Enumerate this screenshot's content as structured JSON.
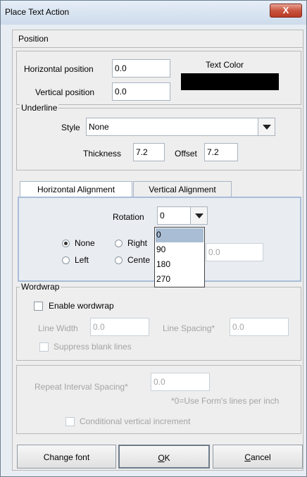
{
  "window": {
    "title": "Place Text Action",
    "close_label": "X"
  },
  "position_section": {
    "title": "Position",
    "horizontal_label": "Horizontal position",
    "horizontal_value": "0.0",
    "vertical_label": "Vertical position",
    "vertical_value": "0.0",
    "text_color_label": "Text Color",
    "text_color": "#000000"
  },
  "underline": {
    "title": "Underline",
    "style_label": "Style",
    "style_value": "None",
    "thickness_label": "Thickness",
    "thickness_value": "7.2",
    "offset_label": "Offset",
    "offset_value": "7.2"
  },
  "tabs": [
    {
      "label": "Horizontal Alignment",
      "active": true
    },
    {
      "label": "Vertical Alignment",
      "active": false
    }
  ],
  "alignment": {
    "rotation_label": "Rotation",
    "rotation_value": "0",
    "rotation_options": [
      "0",
      "90",
      "180",
      "270"
    ],
    "radio_none": "None",
    "radio_right": "Right",
    "radio_left": "Left",
    "radio_center": "Cente",
    "hidden_field_value": "0.0"
  },
  "wordwrap": {
    "title": "Wordwrap",
    "enable_label": "Enable wordwrap",
    "line_width_label": "Line Width",
    "line_width_value": "0.0",
    "line_spacing_label": "Line Spacing*",
    "line_spacing_value": "0.0",
    "suppress_label": "Suppress blank lines"
  },
  "repeat": {
    "label": "Repeat Interval Spacing*",
    "value": "0.0",
    "note": "*0=Use Form's lines per inch",
    "conditional_label": "Conditional vertical increment"
  },
  "buttons": {
    "change_font": "Change font",
    "ok": "OK",
    "cancel": "Cancel"
  }
}
